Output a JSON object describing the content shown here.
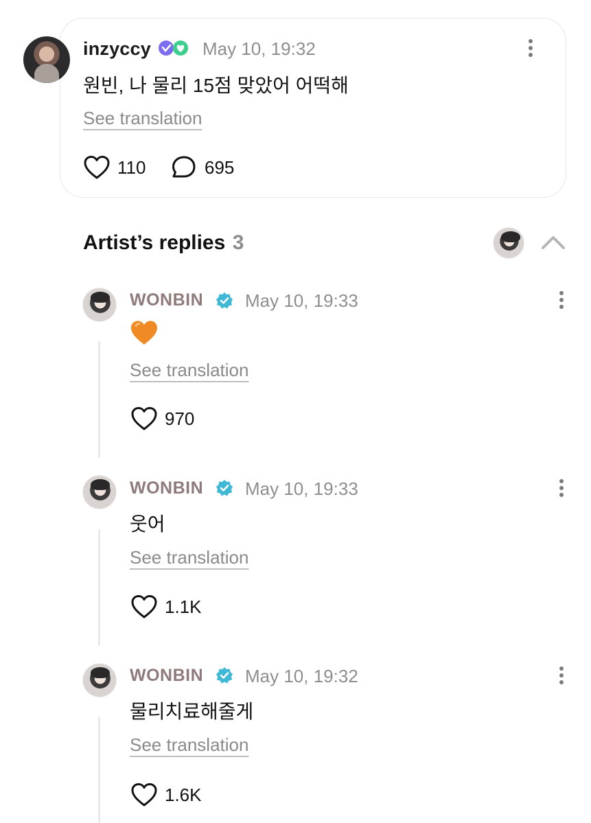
{
  "post": {
    "username": "inzyccy",
    "timestamp": "May 10, 19:32",
    "text": "원빈, 나 물리 15점 맞았어 어떡해",
    "see_translation": "See translation",
    "likes": "110",
    "comments": "695"
  },
  "replies_section": {
    "title": "Artist’s replies",
    "count": "3"
  },
  "replies": [
    {
      "name": "WONBIN",
      "timestamp": "May 10, 19:33",
      "text": "🧡",
      "see_translation": "See translation",
      "likes": "970"
    },
    {
      "name": "WONBIN",
      "timestamp": "May 10, 19:33",
      "text": "웃어",
      "see_translation": "See translation",
      "likes": "1.1K"
    },
    {
      "name": "WONBIN",
      "timestamp": "May 10, 19:32",
      "text": "물리치료해줄게",
      "see_translation": "See translation",
      "likes": "1.6K"
    }
  ],
  "colors": {
    "artist_name": "#8f7b7b",
    "verified_badge": "#3fb8d6",
    "heart_emoji": "#f08a24",
    "badge_purple": "#7b6cf0",
    "badge_green": "#3ecf8e"
  }
}
